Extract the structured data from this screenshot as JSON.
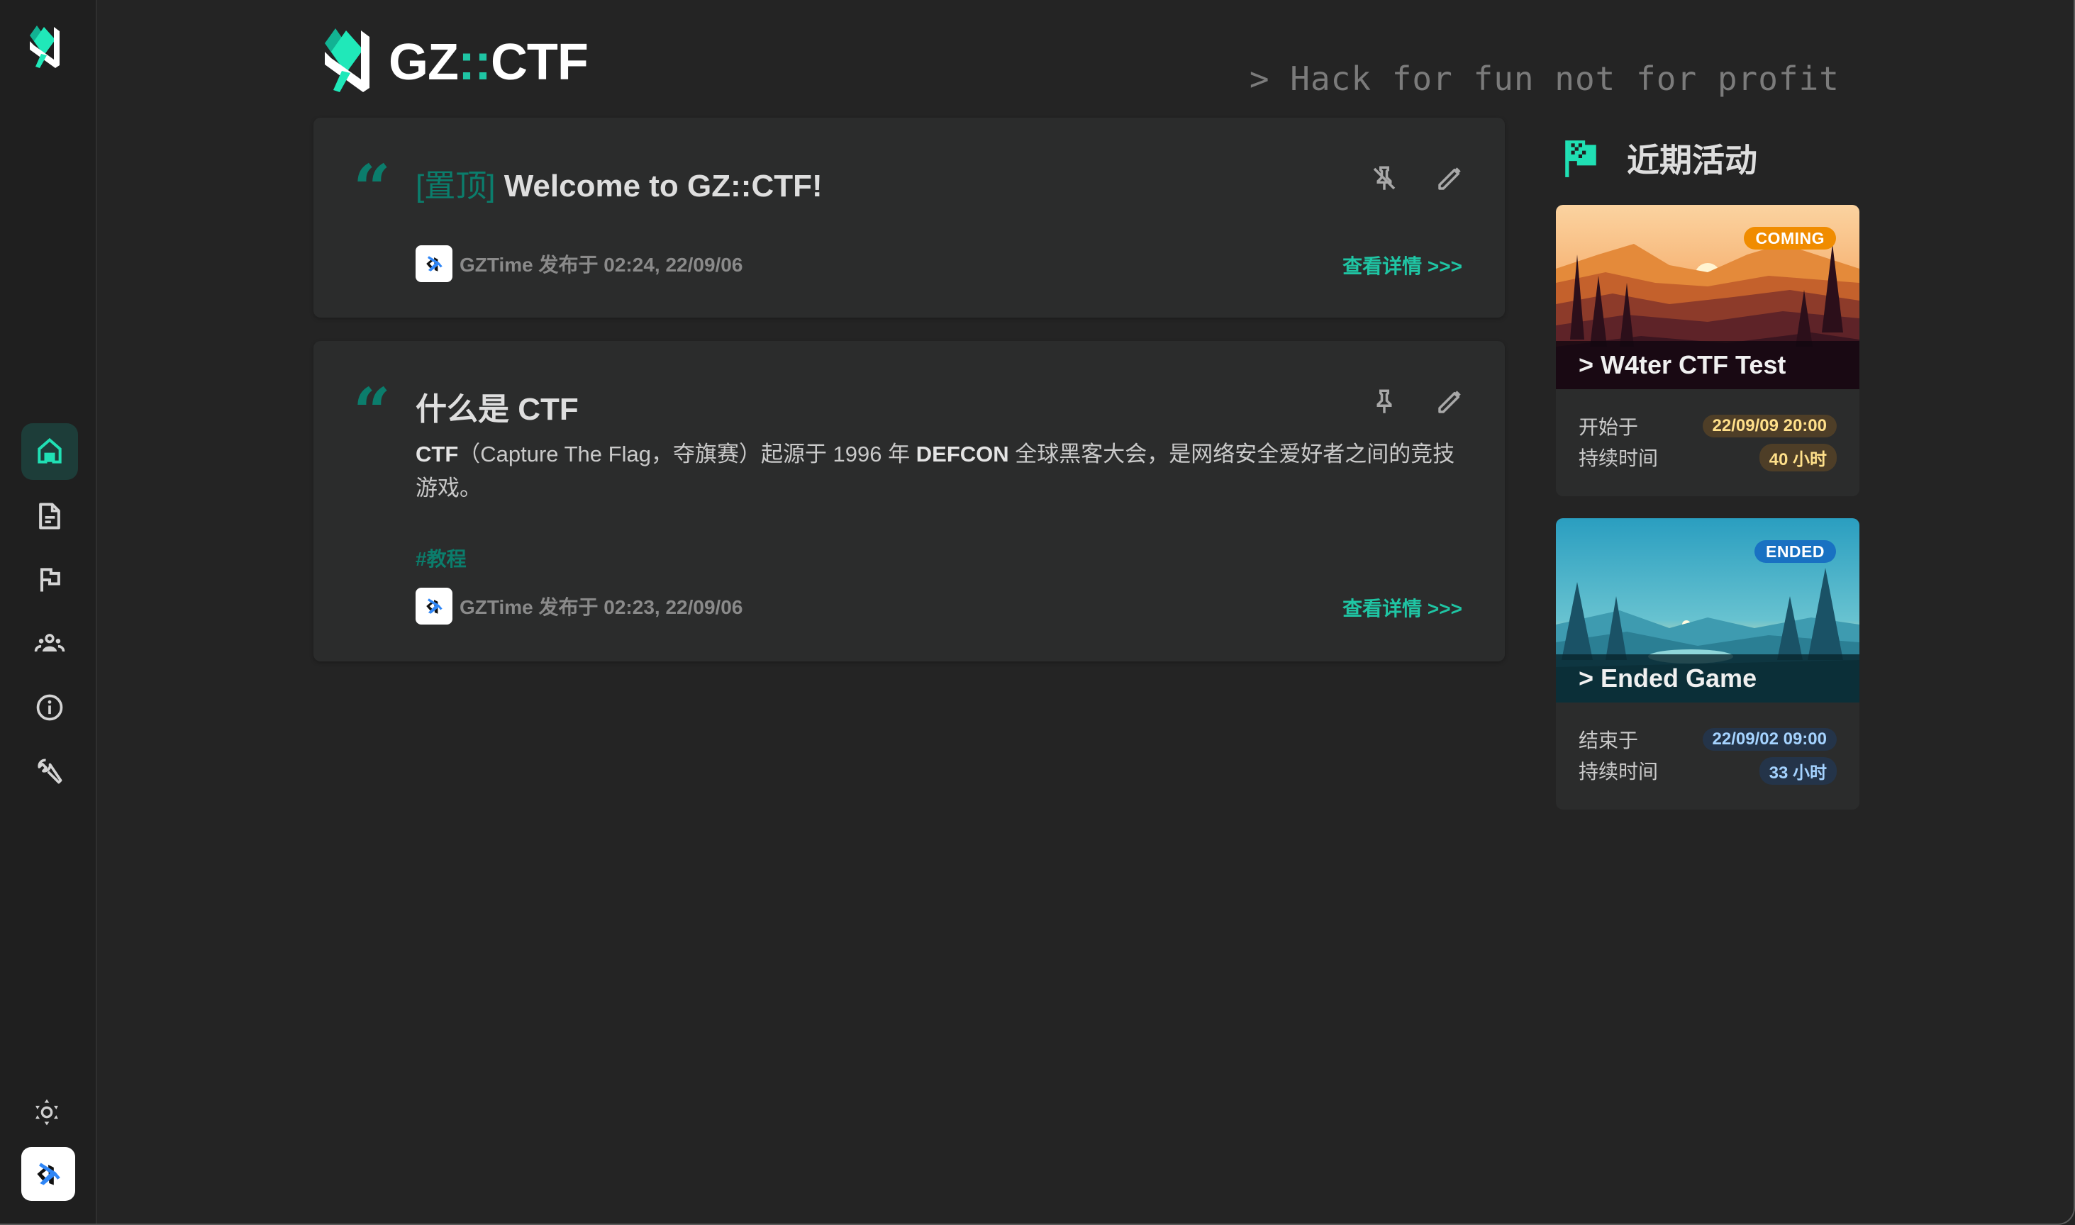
{
  "app": {
    "brand_prefix": "GZ",
    "brand_sep": "::",
    "brand_suffix": "CTF",
    "tagline": "> Hack for fun not for profit"
  },
  "sidebar": {
    "items": [
      {
        "name": "home",
        "icon": "home-icon",
        "active": true
      },
      {
        "name": "posts",
        "icon": "document-icon",
        "active": false
      },
      {
        "name": "games",
        "icon": "flag-icon",
        "active": false
      },
      {
        "name": "teams",
        "icon": "users-icon",
        "active": false
      },
      {
        "name": "about",
        "icon": "info-icon",
        "active": false
      },
      {
        "name": "admin",
        "icon": "wrench-icon",
        "active": false
      }
    ],
    "theme_icon": "sun-icon",
    "user_avatar": "user-avatar"
  },
  "posts": [
    {
      "pinned": true,
      "pin_tag": "[置顶]",
      "title": "Welcome to GZ::CTF!",
      "pin_action_icon": "pin-off-icon",
      "edit_action_icon": "pencil-icon",
      "author_meta": "GZTime 发布于 02:24, 22/09/06",
      "details_link": "查看详情 >>>"
    },
    {
      "pinned": false,
      "title": "什么是 CTF",
      "content": {
        "strong1": "CTF",
        "text1": "（Capture The Flag，夺旗赛）起源于 1996 年 ",
        "strong2": "DEFCON",
        "text2": " 全球黑客大会，是网络安全爱好者之间的竞技游戏。"
      },
      "tag": "#教程",
      "pin_action_icon": "pin-icon",
      "edit_action_icon": "pencil-icon",
      "author_meta": "GZTime 发布于 02:23, 22/09/06",
      "details_link": "查看详情 >>>"
    }
  ],
  "recent": {
    "title": "近期活动",
    "events": [
      {
        "status": "COMING",
        "status_color": "#f08c00",
        "name": "> W4ter CTF Test",
        "time_label": "开始于",
        "time_value": "22/09/09 20:00",
        "duration_label": "持续时间",
        "duration_value": "40 小时"
      },
      {
        "status": "ENDED",
        "status_color": "#1971c2",
        "name": "> Ended Game",
        "time_label": "结束于",
        "time_value": "22/09/02 09:00",
        "duration_label": "持续时间",
        "duration_value": "33 小时"
      }
    ]
  }
}
